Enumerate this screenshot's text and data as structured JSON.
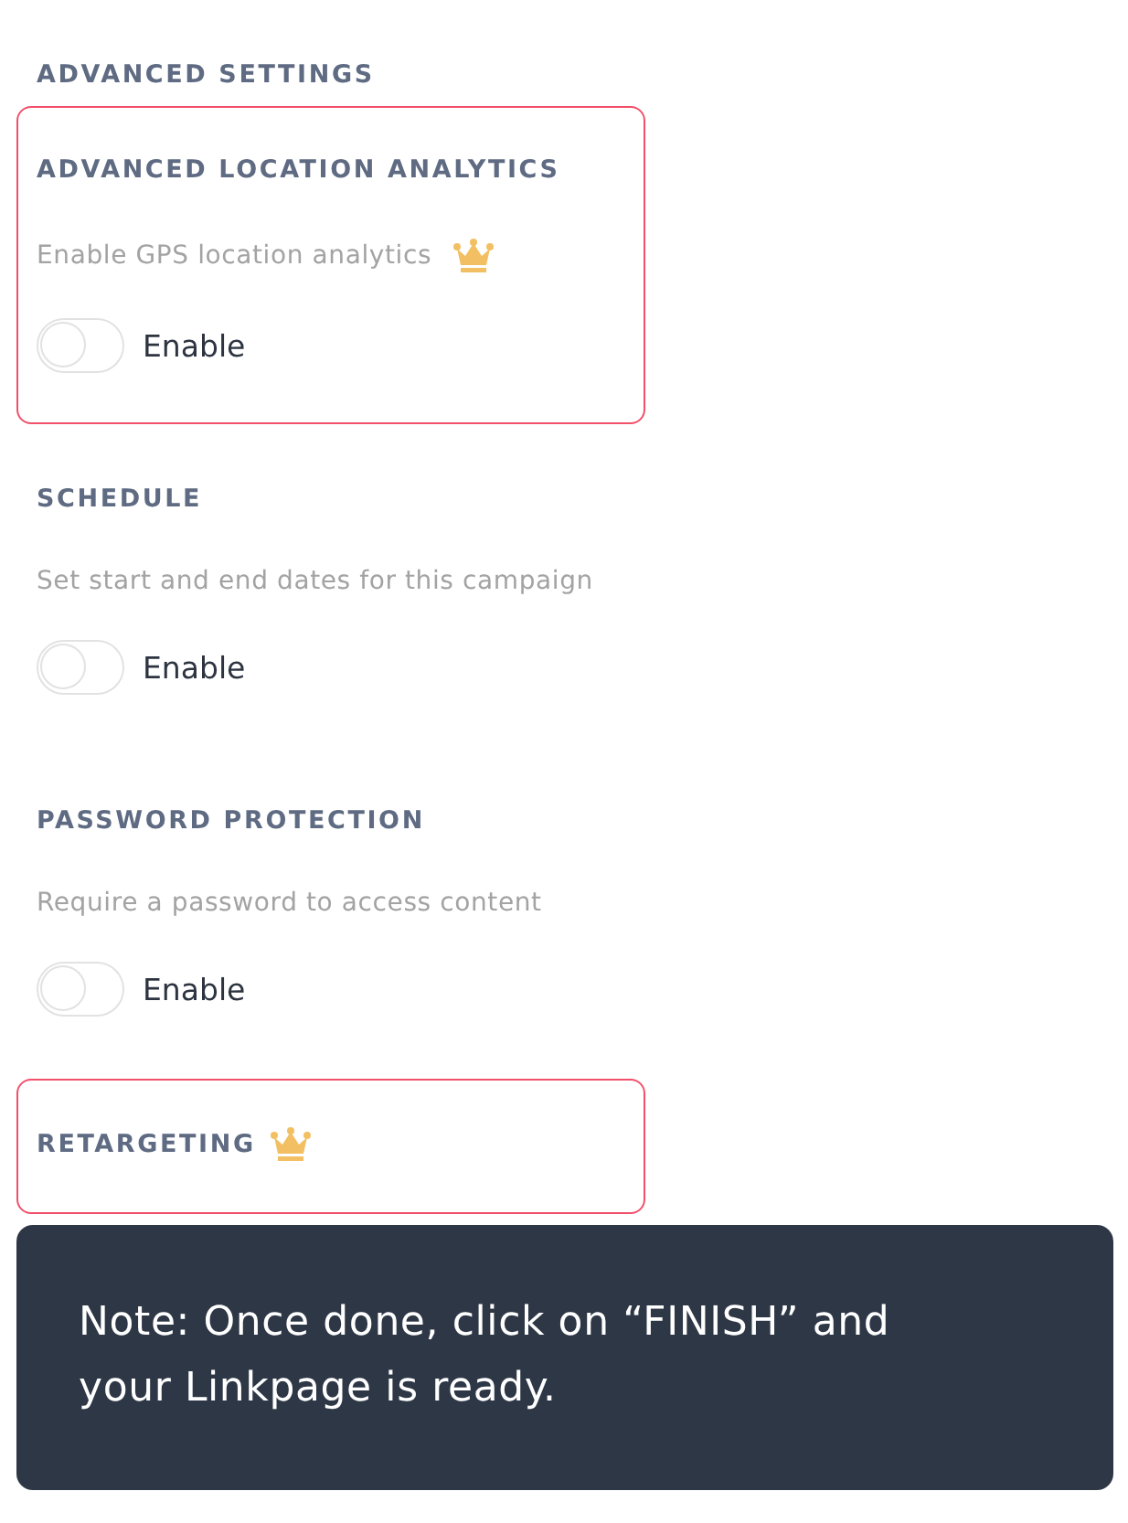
{
  "heading": "ADVANCED SETTINGS",
  "sections": [
    {
      "title": "ADVANCED LOCATION ANALYTICS",
      "title_premium": false,
      "highlighted": true,
      "description": "Enable GPS location analytics",
      "description_premium": true,
      "toggle": {
        "label": "Enable",
        "on": false
      }
    },
    {
      "title": "SCHEDULE",
      "title_premium": false,
      "highlighted": false,
      "description": "Set start and end dates for this campaign",
      "description_premium": false,
      "toggle": {
        "label": "Enable",
        "on": false
      }
    },
    {
      "title": "PASSWORD PROTECTION",
      "title_premium": false,
      "highlighted": false,
      "description": "Require a password to access content",
      "description_premium": false,
      "toggle": {
        "label": "Enable",
        "on": false
      }
    },
    {
      "title": "RETARGETING",
      "title_premium": true,
      "highlighted": true
    }
  ],
  "note": "Note: Once done, click on “FINISH” and your Linkpage is ready."
}
